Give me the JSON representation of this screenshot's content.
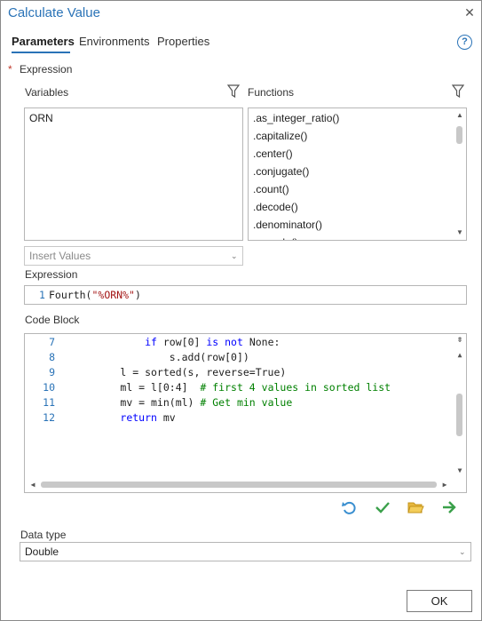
{
  "dialog": {
    "title": "Calculate Value",
    "close_icon": "close-icon"
  },
  "tabs": [
    {
      "label": "Parameters",
      "active": true
    },
    {
      "label": "Environments",
      "active": false
    },
    {
      "label": "Properties",
      "active": false
    }
  ],
  "help_icon": {
    "glyph": "?"
  },
  "expression_section": {
    "required_marker": "*",
    "label": "Expression"
  },
  "variables": {
    "label": "Variables",
    "items": [
      "ORN"
    ]
  },
  "functions": {
    "label": "Functions",
    "items": [
      ".as_integer_ratio()",
      ".capitalize()",
      ".center()",
      ".conjugate()",
      ".count()",
      ".decode()",
      ".denominator()",
      ".encode()"
    ]
  },
  "insert_values": {
    "placeholder": "Insert Values"
  },
  "expression": {
    "label": "Expression",
    "line_number": "1",
    "func": "Fourth(",
    "arg": "\"%ORN%\"",
    "close": ")"
  },
  "code_block": {
    "label": "Code Block",
    "lines": [
      {
        "num": "7",
        "indent": "            ",
        "parts": [
          [
            "kw",
            "if"
          ],
          [
            "t",
            " row[0] "
          ],
          [
            "kw",
            "is not"
          ],
          [
            "t",
            " None:"
          ]
        ]
      },
      {
        "num": "8",
        "indent": "                ",
        "parts": [
          [
            "t",
            "s.add(row[0])"
          ]
        ]
      },
      {
        "num": "9",
        "indent": "        ",
        "parts": [
          [
            "t",
            "l = sorted(s, reverse=True)"
          ]
        ]
      },
      {
        "num": "10",
        "indent": "        ",
        "parts": [
          [
            "t",
            "ml = l[0:4]  "
          ],
          [
            "cm",
            "# first 4 values in sorted list"
          ]
        ]
      },
      {
        "num": "11",
        "indent": "        ",
        "parts": [
          [
            "t",
            "mv = min(ml) "
          ],
          [
            "cm",
            "# Get min value"
          ]
        ]
      },
      {
        "num": "12",
        "indent": "        ",
        "parts": [
          [
            "kw",
            "return"
          ],
          [
            "t",
            " mv"
          ]
        ]
      }
    ]
  },
  "toolbar": {
    "icons": [
      "undo-icon",
      "verify-checkmark-icon",
      "open-folder-icon",
      "run-arrow-icon"
    ]
  },
  "data_type": {
    "label": "Data type",
    "value": "Double"
  },
  "ok_button": {
    "label": "OK"
  }
}
